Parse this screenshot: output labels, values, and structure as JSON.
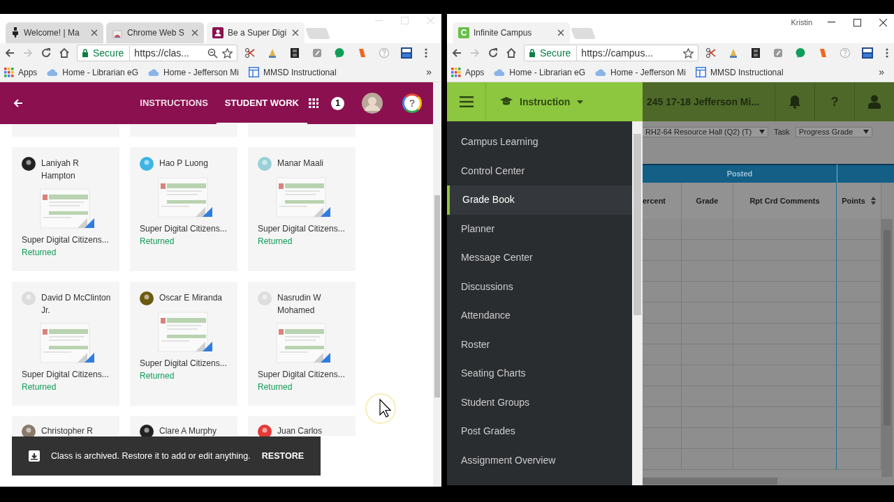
{
  "left_window": {
    "tabs": [
      {
        "title": "Welcome! | Ma",
        "selected": false
      },
      {
        "title": "Chrome Web S",
        "selected": false
      },
      {
        "title": "Be a Super Digi",
        "selected": true
      }
    ],
    "toolbar": {
      "secure_label": "Secure",
      "url": "https://clas..."
    },
    "bookmarks": [
      {
        "label": "Apps"
      },
      {
        "label": "Home - Librarian eG"
      },
      {
        "label": "Home - Jefferson Mi"
      },
      {
        "label": "MMSD Instructional"
      }
    ],
    "bookmarks_overflow": "»",
    "classroom_header": {
      "tabs": [
        {
          "label": "INSTRUCTIONS",
          "selected": false
        },
        {
          "label": "STUDENT WORK",
          "selected": true
        }
      ],
      "notification_count": "1",
      "help_label": "?"
    },
    "submissions": [
      {
        "name": "Laniyah R Hampton",
        "title": "Super Digital Citizens...",
        "status": "Returned"
      },
      {
        "name": "Hao P Luong",
        "title": "Super Digital Citizens...",
        "status": "Returned"
      },
      {
        "name": "Manar Maali",
        "title": "Super Digital Citizens...",
        "status": "Returned"
      },
      {
        "name": "David D McClinton Jr.",
        "title": "Super Digital Citizens...",
        "status": "Returned"
      },
      {
        "name": "Oscar E Miranda",
        "title": "Super Digital Citizens...",
        "status": "Returned"
      },
      {
        "name": "Nasrudin W Mohamed",
        "title": "Super Digital Citizens...",
        "status": "Returned"
      },
      {
        "name": "Christopher R"
      },
      {
        "name": "Clare A Murphy"
      },
      {
        "name": "Juan Carlos"
      }
    ],
    "snackbar": {
      "message": "Class is archived. Restore it to add or edit anything.",
      "action": "RESTORE"
    }
  },
  "right_window": {
    "profile_name": "Kristin",
    "tabs": [
      {
        "title": "Infinite Campus",
        "logo": "C",
        "selected": true
      }
    ],
    "toolbar": {
      "secure_label": "Secure",
      "url": "https://campus..."
    },
    "bookmarks": [
      {
        "label": "Apps"
      },
      {
        "label": "Home - Librarian eG"
      },
      {
        "label": "Home - Jefferson Mi"
      },
      {
        "label": "MMSD Instructional"
      }
    ],
    "bookmarks_overflow": "»",
    "app_header": {
      "menu_label": "Instruction",
      "school": "245 17-18 Jefferson Mi...",
      "help_label": "?"
    },
    "menu": [
      {
        "label": "Campus Learning",
        "selected": false
      },
      {
        "label": "Control Center",
        "selected": false
      },
      {
        "label": "Grade Book",
        "selected": true
      },
      {
        "label": "Planner",
        "selected": false
      },
      {
        "label": "Message Center",
        "selected": false
      },
      {
        "label": "Discussions",
        "selected": false
      },
      {
        "label": "Attendance",
        "selected": false
      },
      {
        "label": "Roster",
        "selected": false
      },
      {
        "label": "Seating Charts",
        "selected": false
      },
      {
        "label": "Student Groups",
        "selected": false
      },
      {
        "label": "Post Grades",
        "selected": false
      },
      {
        "label": "Assignment Overview",
        "selected": false
      }
    ],
    "filters": {
      "section": "RH2-64 Resource Hall (Q2) (T)",
      "task_label": "Task",
      "task": "Progress Grade"
    },
    "gradebook": {
      "group_header": "Posted",
      "columns": [
        "ercent",
        "Grade",
        "Rpt Crd Comments",
        "Points"
      ]
    }
  }
}
